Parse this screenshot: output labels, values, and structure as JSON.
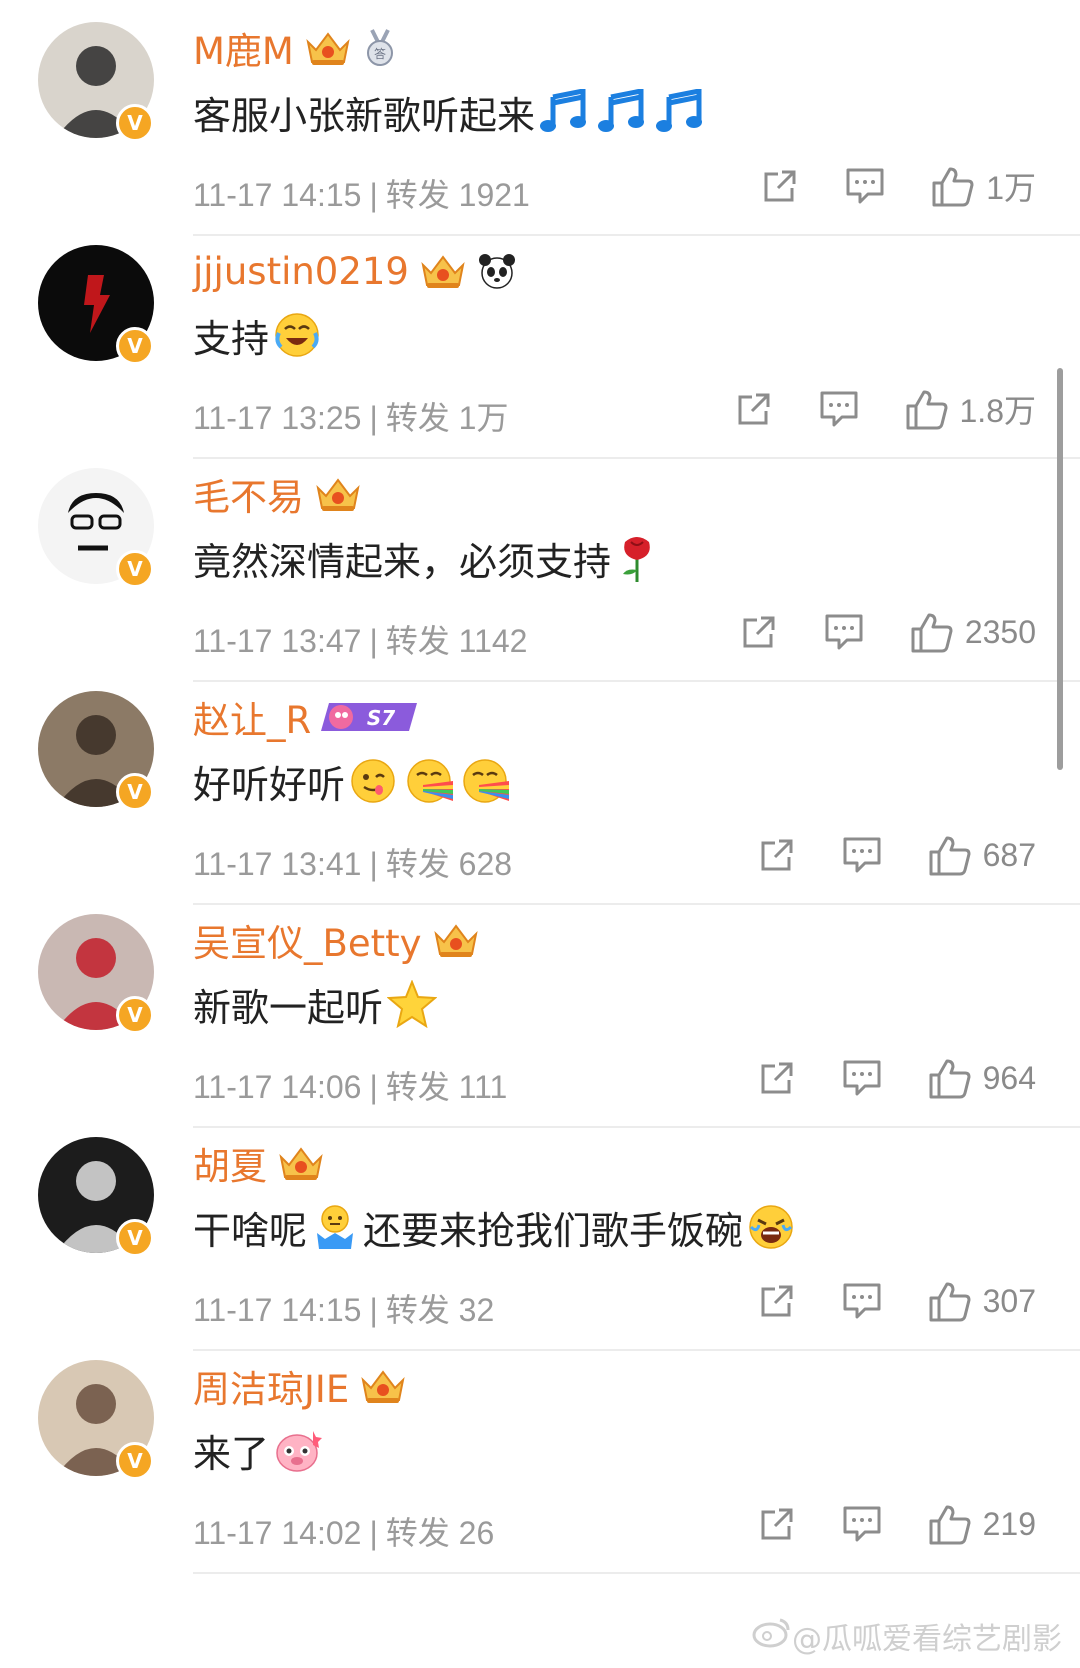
{
  "colors": {
    "name": "#e8772e",
    "text": "#222222",
    "meta": "#9a9a9a",
    "badge": "#f5a623"
  },
  "comments": [
    {
      "name": "M鹿M",
      "badges": [
        "crown-badge",
        "medal-badge"
      ],
      "text": [
        "客服小张新歌听起来"
      ],
      "emojis_after": [
        "music-note-emoji",
        "music-note-emoji",
        "music-note-emoji"
      ],
      "time": "11-17 14:15",
      "repost_label": "转发",
      "repost_count": "1921",
      "likes": "1万"
    },
    {
      "name": "jjjustin0219",
      "badges": [
        "crown-badge",
        "panda-badge"
      ],
      "text": [
        "支持"
      ],
      "emojis_after": [
        "laughing-crying-emoji"
      ],
      "time": "11-17 13:25",
      "repost_label": "转发",
      "repost_count": "1万",
      "likes": "1.8万"
    },
    {
      "name": "毛不易",
      "badges": [
        "crown-badge"
      ],
      "text": [
        "竟然深情起来，必须支持"
      ],
      "emojis_after": [
        "rose-emoji"
      ],
      "time": "11-17 13:47",
      "repost_label": "转发",
      "repost_count": "1142",
      "likes": "2350"
    },
    {
      "name": "赵让_R",
      "badges": [
        "s7-badge"
      ],
      "badge_text": "S7",
      "text": [
        "好听好听"
      ],
      "emojis_after": [
        "yummy-emoji",
        "rainbow-emoji",
        "rainbow-emoji"
      ],
      "time": "11-17 13:41",
      "repost_label": "转发",
      "repost_count": "628",
      "likes": "687"
    },
    {
      "name": "吴宣仪_Betty",
      "badges": [
        "crown-badge"
      ],
      "text": [
        "新歌一起听"
      ],
      "emojis_after": [
        "star-emoji"
      ],
      "time": "11-17 14:06",
      "repost_label": "转发",
      "repost_count": "111",
      "likes": "964"
    },
    {
      "name": "胡夏",
      "badges": [
        "crown-badge"
      ],
      "text": [
        "干啥呢",
        "还要来抢我们歌手饭碗"
      ],
      "emojis_mid": [
        "shrug-emoji"
      ],
      "emojis_after": [
        "crying-emoji"
      ],
      "time": "11-17 14:15",
      "repost_label": "转发",
      "repost_count": "32",
      "likes": "307"
    },
    {
      "name": "周洁琼JIE",
      "badges": [
        "crown-badge"
      ],
      "text": [
        "来了"
      ],
      "emojis_after": [
        "cute-pig-emoji"
      ],
      "time": "11-17 14:02",
      "repost_label": "转发",
      "repost_count": "26",
      "likes": "219"
    }
  ],
  "verified_mark": "V",
  "watermark": "@瓜呱爱看综艺剧影"
}
